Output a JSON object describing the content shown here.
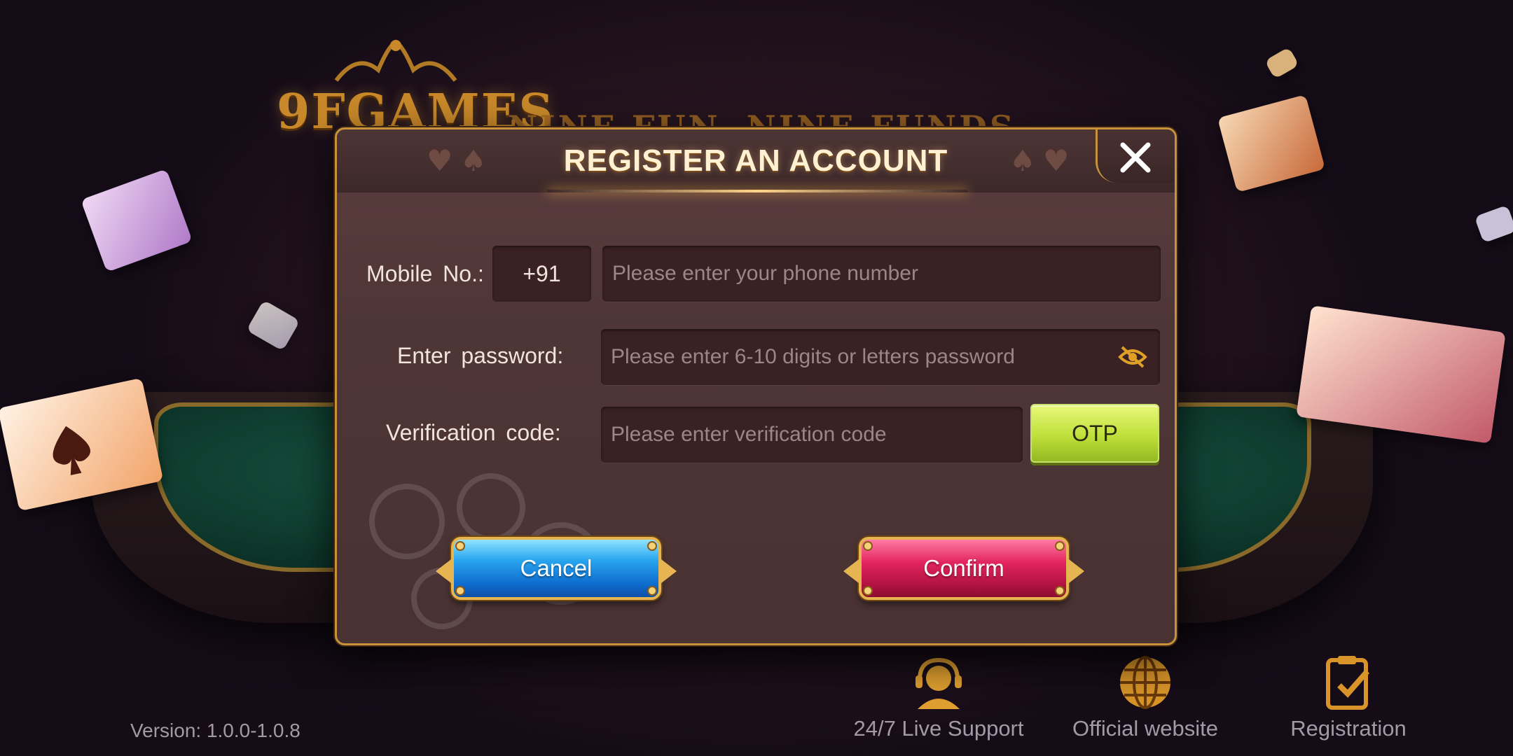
{
  "background": {
    "logo_text": "9FGAMES",
    "slogan": "NINE FUN, NINE FUNDS",
    "version": "Version: 1.0.0-1.0.8"
  },
  "dialog": {
    "title": "REGISTER AN ACCOUNT",
    "close_icon": "close-icon",
    "mobile_label": "Mobile  No.:",
    "country_code": "+91",
    "phone_placeholder": "Please enter your phone number",
    "password_label": "Enter password:",
    "password_placeholder": "Please enter 6-10 digits or letters password",
    "password_visibility_icon": "eye-off-icon",
    "verification_label": "Verification  code:",
    "verification_placeholder": "Please enter verification code",
    "otp_label": "OTP",
    "cancel_label": "Cancel",
    "confirm_label": "Confirm"
  },
  "bottom_nav": [
    {
      "label": "24/7 Live Support",
      "icon": "headset-icon"
    },
    {
      "label": "Official website",
      "icon": "globe-icon"
    },
    {
      "label": "Registration",
      "icon": "clipboard-check-icon"
    }
  ],
  "colors": {
    "dialog_border": "#c8923c",
    "otp_button": "#bfe03a",
    "cancel_button": "#1a86e0",
    "confirm_button": "#d21a52"
  }
}
